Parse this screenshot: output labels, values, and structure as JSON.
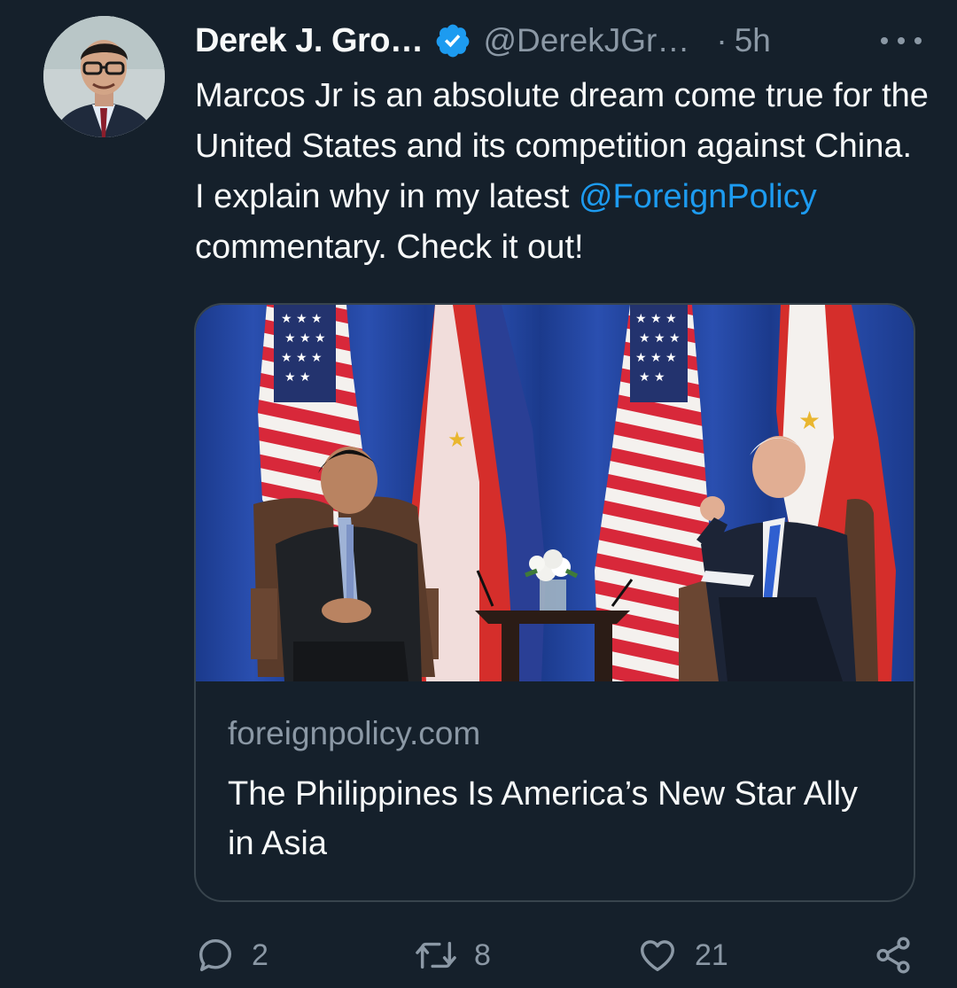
{
  "tweet": {
    "author": {
      "display_name": "Derek J. Gro…",
      "handle": "@DerekJGr…",
      "verified": true
    },
    "separator": "·",
    "timestamp": "5h",
    "text_plain_1": "Marcos Jr is an absolute dream come true for the United States and its competition against China. I explain why in my latest ",
    "mention": "@ForeignPolicy",
    "text_plain_2": " commentary. Check it out!",
    "card": {
      "domain": "foreignpolicy.com",
      "title": "The Philippines Is America’s New Star Ally in Asia"
    },
    "actions": {
      "replies": "2",
      "retweets": "8",
      "likes": "21"
    }
  },
  "colors": {
    "background": "#15202b",
    "text_primary": "#f7f9f9",
    "text_secondary": "#8b98a5",
    "accent": "#1d9bf0",
    "border": "#38444d"
  },
  "icons": {
    "more": "more-horizontal-icon",
    "verified": "verified-badge-icon",
    "reply": "reply-icon",
    "retweet": "retweet-icon",
    "like": "heart-icon",
    "share": "share-icon"
  }
}
